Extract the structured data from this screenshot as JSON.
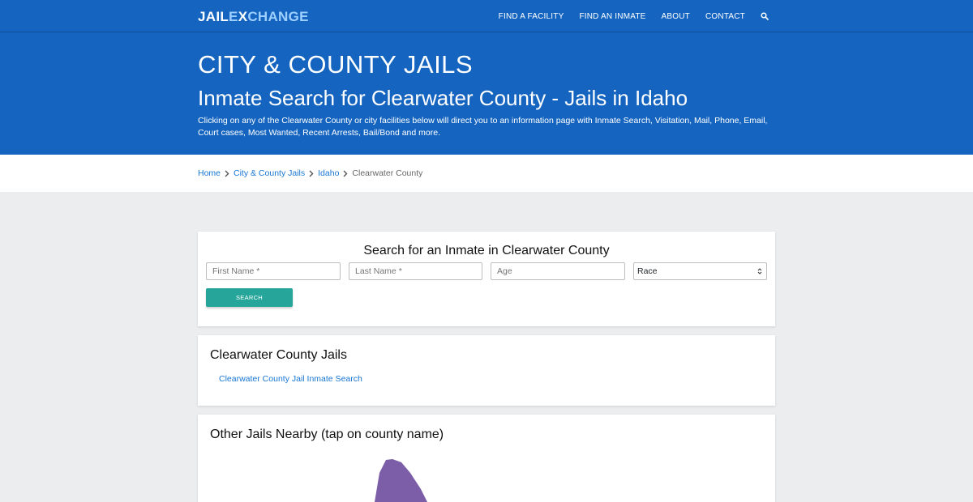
{
  "brand": {
    "part1": "JAIL",
    "part2": "E",
    "part3": "X",
    "part4": "CHANGE",
    "accent_color": "#9ed0ff"
  },
  "nav": {
    "items": [
      "FIND A FACILITY",
      "FIND AN INMATE",
      "ABOUT",
      "CONTACT"
    ],
    "search_icon": "search-icon"
  },
  "hero": {
    "category": "CITY & COUNTY JAILS",
    "title": "Inmate Search for Clearwater County - Jails in Idaho",
    "description": "Clicking on any of the Clearwater County or city facilities below will direct you to an information page with Inmate Search, Visitation, Mail, Phone, Email, Court cases, Most Wanted, Recent Arrests, Bail/Bond and more."
  },
  "breadcrumb": {
    "items": [
      "Home",
      "City & County Jails",
      "Idaho"
    ],
    "current": "Clearwater County"
  },
  "search": {
    "title": "Search for an Inmate in Clearwater County",
    "first_name_placeholder": "First Name *",
    "last_name_placeholder": "Last Name *",
    "age_placeholder": "Age",
    "race_selected": "Race",
    "button_label": "SEARCH"
  },
  "county_jails": {
    "heading": "Clearwater County Jails",
    "links": [
      "Clearwater County Jail Inmate Search"
    ]
  },
  "nearby": {
    "heading": "Other Jails Nearby (tap on county name)",
    "map_color": "#7b5ea7"
  },
  "colors": {
    "primary_blue": "#1565c0",
    "link_blue": "#1976d2",
    "button_teal": "#26a69a",
    "page_bg": "#ebedef"
  }
}
